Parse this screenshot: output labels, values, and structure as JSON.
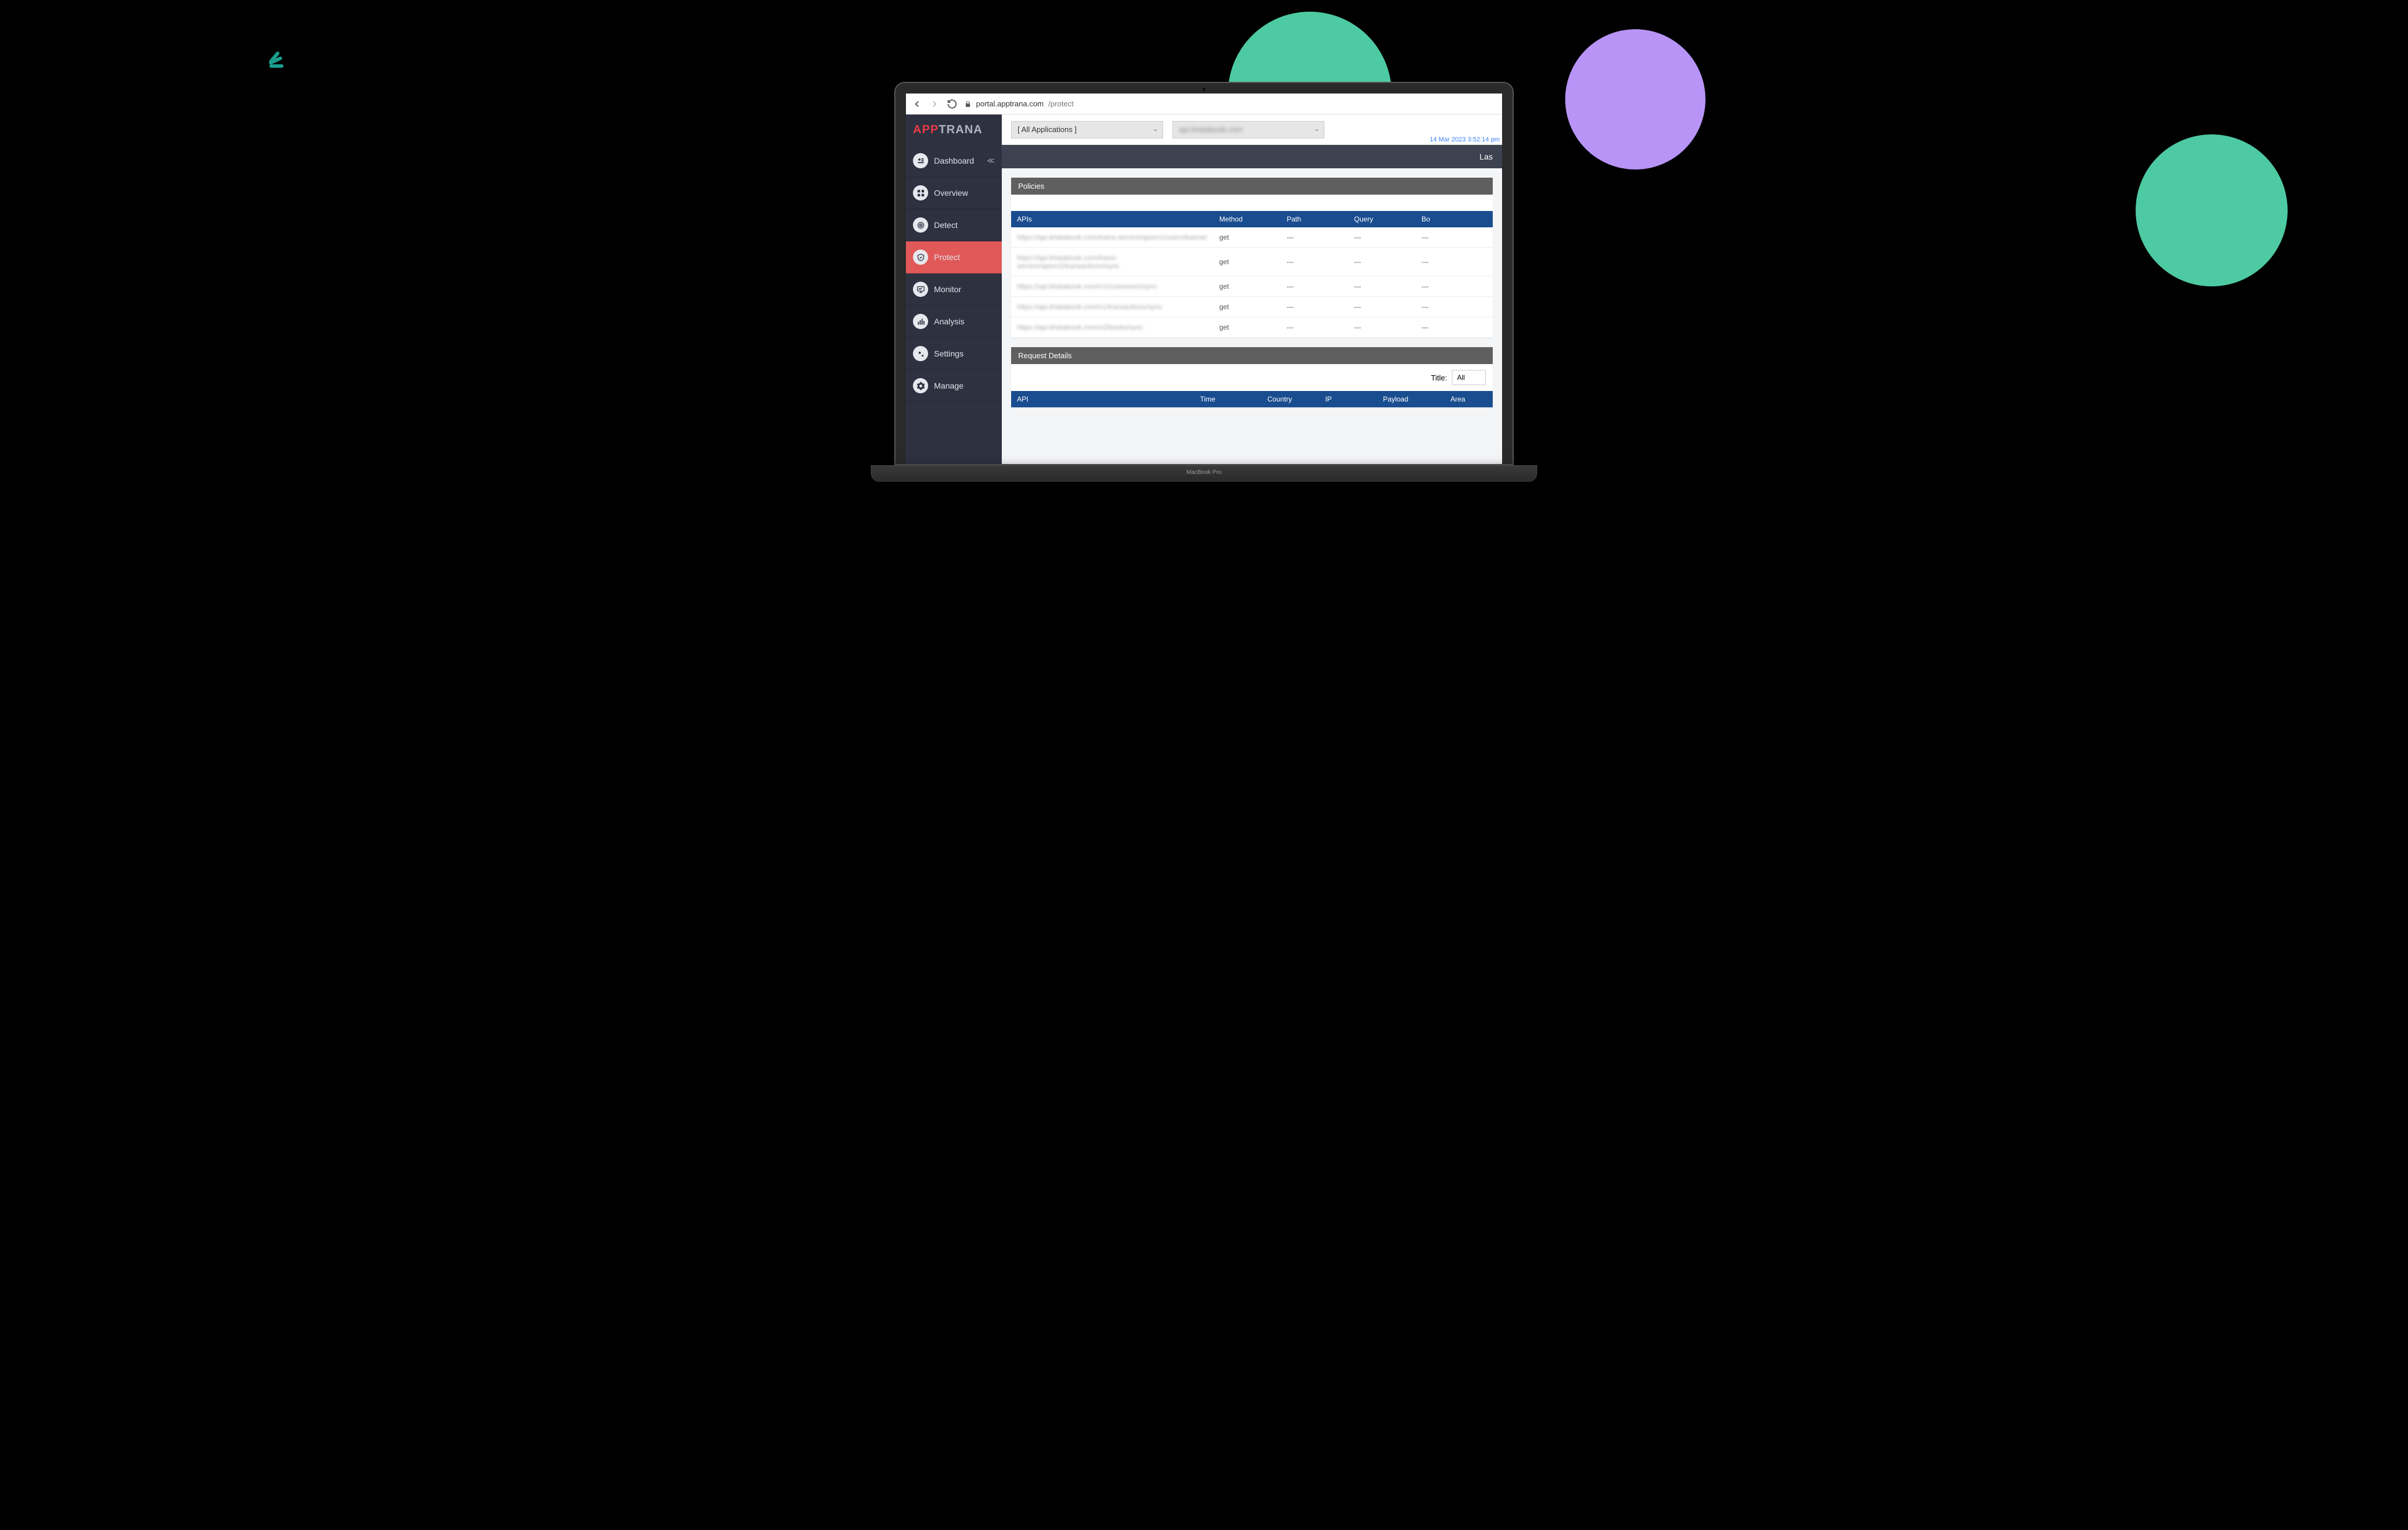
{
  "browser": {
    "host": "portal.apptrana.com",
    "path": "/protect"
  },
  "brand": {
    "part1": "APP",
    "part2": "TRANA"
  },
  "sidebar": {
    "items": [
      {
        "label": "Dashboard",
        "icon": "dashboard",
        "has_collapse": true
      },
      {
        "label": "Overview",
        "icon": "overview"
      },
      {
        "label": "Detect",
        "icon": "target"
      },
      {
        "label": "Protect",
        "icon": "shield",
        "active": true
      },
      {
        "label": "Monitor",
        "icon": "monitor"
      },
      {
        "label": "Analysis",
        "icon": "chart"
      },
      {
        "label": "Settings",
        "icon": "gears"
      },
      {
        "label": "Manage",
        "icon": "gear"
      }
    ]
  },
  "topbar": {
    "dropdown1": "[ All Applications ]",
    "dropdown2_blurred": "api.khatabook.com",
    "timestamp": "14 Mar 2023 3:52:14 pm"
  },
  "subheader": {
    "right_label": "Las"
  },
  "policies": {
    "title": "Policies",
    "columns": [
      "APIs",
      "Method",
      "Path",
      "Query",
      "Bo"
    ],
    "rows": [
      {
        "api": "https://api.khatabook.com/loans-service/apis/v1/users/banner",
        "method": "get",
        "path": "---",
        "query": "---",
        "body": "---"
      },
      {
        "api": "https://api.khatabook.com/loans-service/apis/v2/transactions/sync",
        "method": "get",
        "path": "---",
        "query": "---",
        "body": "---"
      },
      {
        "api": "https://api.khatabook.com/v1/customers/sync",
        "method": "get",
        "path": "---",
        "query": "---",
        "body": "---"
      },
      {
        "api": "https://api.khatabook.com/v1/transactions/sync",
        "method": "get",
        "path": "---",
        "query": "---",
        "body": "---"
      },
      {
        "api": "https://api.khatabook.com/v2/books/sync",
        "method": "get",
        "path": "---",
        "query": "---",
        "body": "---"
      }
    ]
  },
  "request_details": {
    "title": "Request Details",
    "filter_label": "Title:",
    "filter_value": "All",
    "columns": [
      "API",
      "Time",
      "Country",
      "IP",
      "Payload",
      "Area"
    ]
  },
  "laptop": {
    "label": "MacBook Pro"
  }
}
